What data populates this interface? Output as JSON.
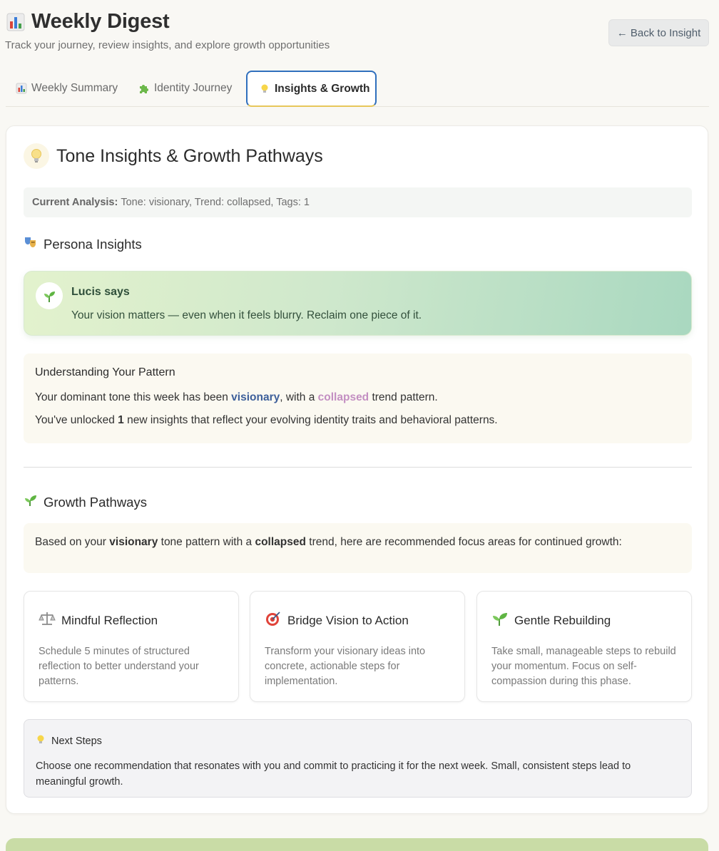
{
  "header": {
    "title": "Weekly Digest",
    "title_icon": "bar-chart-icon",
    "subtitle": "Track your journey, review insights, and explore growth opportunities",
    "back_label": "← Back to Insight"
  },
  "tabs": [
    {
      "label": "Weekly Summary",
      "icon": "bar-chart-icon",
      "active": false
    },
    {
      "label": "Identity Journey",
      "icon": "puzzle-icon",
      "active": false
    },
    {
      "label": "Insights & Growth",
      "icon": "lightbulb-icon",
      "active": true
    }
  ],
  "insights": {
    "title": "Tone Insights & Growth Pathways",
    "analysis_label": "Current Analysis:",
    "analysis_value": "Tone: visionary, Trend: collapsed, Tags: 1"
  },
  "persona": {
    "heading": "Persona Insights",
    "speaker": "Lucis says",
    "message": "Your vision matters — even when it feels blurry. Reclaim one piece of it."
  },
  "pattern": {
    "title": "Understanding Your Pattern",
    "line1_pre": "Your dominant tone this week has been ",
    "tone": "visionary",
    "line1_mid": ", with a ",
    "trend": "collapsed",
    "line1_post": " trend pattern.",
    "line2_pre": "You've unlocked ",
    "count": "1",
    "line2_post": " new insights that reflect your evolving identity traits and behavioral patterns."
  },
  "growth": {
    "heading": "Growth Pathways",
    "intro_pre": "Based on your ",
    "tone": "visionary",
    "intro_mid": " tone pattern with a ",
    "trend": "collapsed",
    "intro_post": " trend, here are recommended focus areas for continued growth:",
    "tiles": [
      {
        "icon": "balance-scale-icon",
        "title": "Mindful Reflection",
        "desc": "Schedule 5 minutes of structured reflection to better understand your patterns."
      },
      {
        "icon": "target-icon",
        "title": "Bridge Vision to Action",
        "desc": "Transform your visionary ideas into concrete, actionable steps for implementation."
      },
      {
        "icon": "seedling-icon",
        "title": "Gentle Rebuilding",
        "desc": "Take small, manageable steps to rebuild your momentum. Focus on self-compassion during this phase."
      }
    ]
  },
  "next_steps": {
    "heading": "Next Steps",
    "text": "Choose one recommendation that resonates with you and commit to practicing it for the next week. Small, consistent steps lead to meaningful growth."
  },
  "colors": {
    "accent_tab_border": "#2f6fbd",
    "tone_highlight": "#3d5f9a",
    "trend_highlight": "#c38fc2",
    "lucis_gradient_start": "#e3f2cd",
    "lucis_gradient_end": "#a9d8c0"
  }
}
